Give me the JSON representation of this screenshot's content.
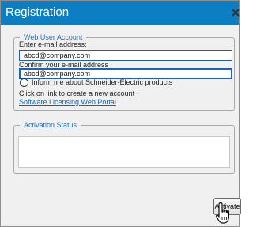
{
  "window": {
    "title": "Registration",
    "close_icon": "close-icon"
  },
  "web_user_account": {
    "legend": "Web User Account",
    "email_label": "Enter e-mail address:",
    "email_value": "abcd@company.com",
    "confirm_label": "Confirm your e-mail address",
    "confirm_value": "abcd@company.com",
    "inform_label": "Inform me about Schneider-Electric products",
    "inform_checked": false,
    "link_prompt": "Click on link to create a new account",
    "link_text": "Software Licensing Web Portal"
  },
  "activation_status": {
    "legend": "Activation Status",
    "status_text": ""
  },
  "actions": {
    "activate_label": "Activate"
  },
  "colors": {
    "titlebar": "#0c7fc4",
    "legend_text": "#1e6fc4",
    "link": "#0066cc"
  }
}
